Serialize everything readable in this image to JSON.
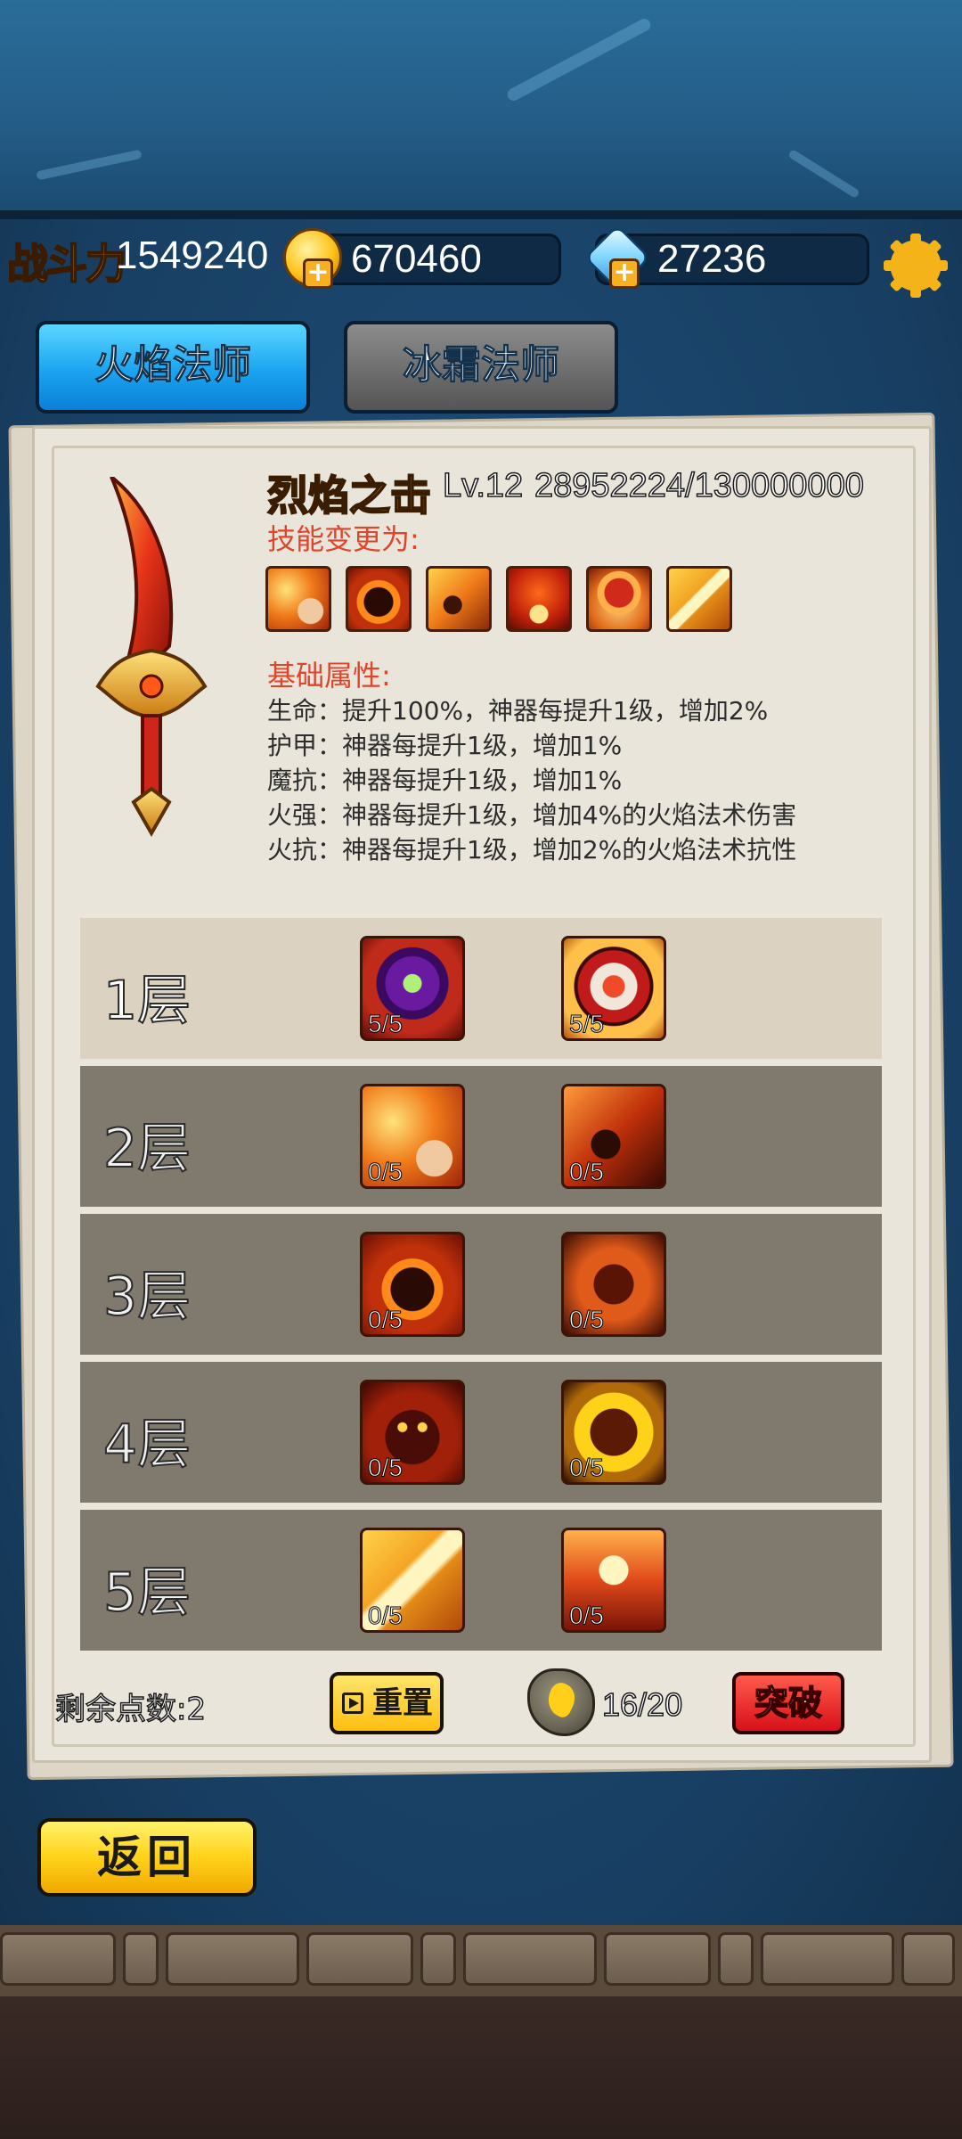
{
  "hud": {
    "power_label": "战斗力",
    "power_value": "1549240",
    "gold_value": "670460",
    "diamond_value": "27236",
    "plus": "+"
  },
  "tabs": [
    {
      "label": "火焰法师",
      "active": true
    },
    {
      "label": "冰霜法师",
      "active": false
    }
  ],
  "artifact": {
    "name": "烈焰之击",
    "level": "Lv.12",
    "exp": "28952224/130000000",
    "change_label": "技能变更为:",
    "skill_icons": [
      "fire-fist-icon",
      "fire-orb-icon",
      "meteor-icon",
      "flame-burst-icon",
      "fire-explosion-icon",
      "fire-slash-icon"
    ],
    "base_label": "基础属性:",
    "attributes": [
      "生命：提升100%，神器每提升1级，增加2%",
      "护甲：神器每提升1级，增加1%",
      "魔抗：神器每提升1级，增加1%",
      "火强：神器每提升1级，增加4%的火焰法术伤害",
      "火抗：神器每提升1级，增加2%的火焰法术抗性"
    ]
  },
  "tiers": [
    {
      "label": "1层",
      "a": {
        "icon": "purple-gem-ring-icon",
        "count": "5/5"
      },
      "b": {
        "icon": "fire-shield-icon",
        "count": "5/5"
      }
    },
    {
      "label": "2层",
      "a": {
        "icon": "fire-fist-icon",
        "count": "0/5"
      },
      "b": {
        "icon": "meteor-icon",
        "count": "0/5"
      }
    },
    {
      "label": "3层",
      "a": {
        "icon": "fire-orb-icon",
        "count": "0/5"
      },
      "b": {
        "icon": "fire-golem-icon",
        "count": "0/5"
      }
    },
    {
      "label": "4层",
      "a": {
        "icon": "fire-demon-icon",
        "count": "0/5"
      },
      "b": {
        "icon": "fire-skull-icon",
        "count": "0/5"
      }
    },
    {
      "label": "5层",
      "a": {
        "icon": "fire-slash-icon",
        "count": "0/5"
      },
      "b": {
        "icon": "fire-strike-icon",
        "count": "0/5"
      }
    }
  ],
  "footer": {
    "points_left": "剩余点数:2",
    "reset_label": "重置",
    "stone_count": "16/20",
    "break_label": "突破",
    "back_label": "返回"
  },
  "colors": {
    "accent_gold": "#ffd23a",
    "fire_tab": "#1aa4f0",
    "ice_tab": "#6b6b6b",
    "red_text": "#e0442b",
    "break_red": "#d8101a",
    "back_yellow": "#ffd21a"
  }
}
